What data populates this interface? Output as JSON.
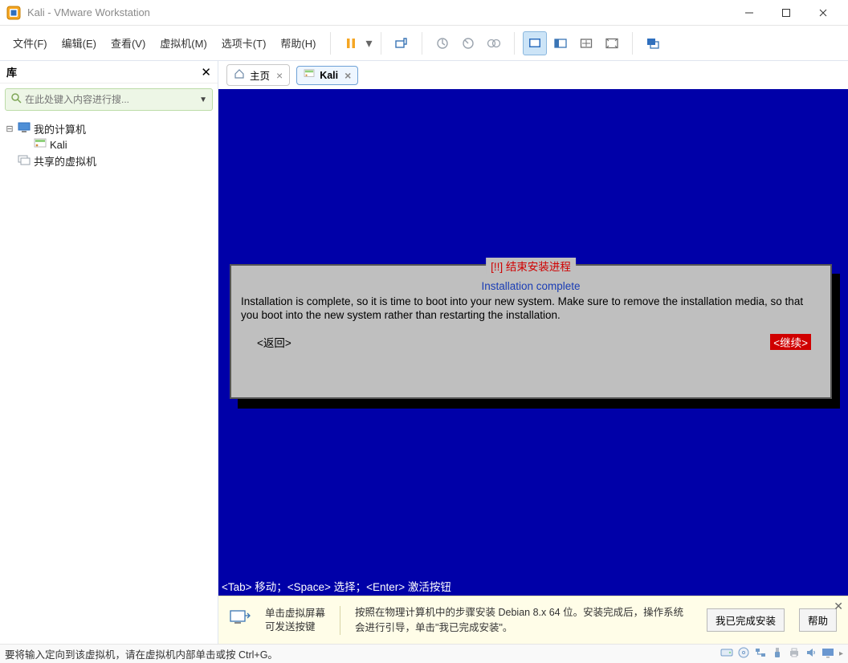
{
  "window": {
    "title": "Kali - VMware Workstation"
  },
  "menu": {
    "file": "文件(F)",
    "edit": "编辑(E)",
    "view": "查看(V)",
    "vm": "虚拟机(M)",
    "tabs": "选项卡(T)",
    "help": "帮助(H)"
  },
  "sidebar": {
    "header": "库",
    "search_placeholder": "在此处键入内容进行搜...",
    "nodes": {
      "my_computer": "我的计算机",
      "kali": "Kali",
      "shared": "共享的虚拟机"
    }
  },
  "tabs": {
    "home": "主页",
    "kali": "Kali"
  },
  "installer": {
    "frame_title": "[!!] 结束安装进程",
    "subtitle": "Installation complete",
    "body": "Installation is complete, so it is time to boot into your new system. Make sure to remove the installation media, so that you boot into the new system rather than restarting the installation.",
    "back": "<返回>",
    "continue": "<继续>",
    "hint": "<Tab> 移动；<Space> 选择；<Enter> 激活按钮"
  },
  "helper": {
    "line1a": "单击虚拟屏幕",
    "line1b": "可发送按键",
    "line2": "按照在物理计算机中的步骤安装 Debian 8.x 64 位。安装完成后，操作系统会进行引导，单击\"我已完成安装\"。",
    "btn_done": "我已完成安装",
    "btn_help": "帮助"
  },
  "status": {
    "message": "要将输入定向到该虚拟机，请在虚拟机内部单击或按 Ctrl+G。"
  }
}
